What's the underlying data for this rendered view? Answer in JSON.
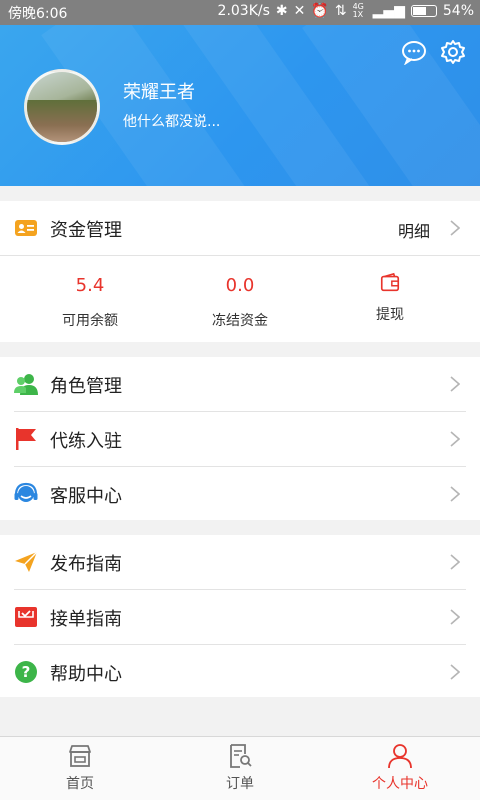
{
  "status": {
    "time": "傍晚6:06",
    "speed": "2.03K/s",
    "net_label": "4G 1X",
    "battery": "54%"
  },
  "profile": {
    "name": "荣耀王者",
    "signature": "他什么都没说..."
  },
  "funds": {
    "title": "资金管理",
    "detail": "明细",
    "available_value": "5.4",
    "available_label": "可用余额",
    "frozen_value": "0.0",
    "frozen_label": "冻结资金",
    "withdraw_label": "提现"
  },
  "menu1": [
    {
      "label": "角色管理",
      "icon": "person-icon"
    },
    {
      "label": "代练入驻",
      "icon": "flag-icon"
    },
    {
      "label": "客服中心",
      "icon": "headset-icon"
    }
  ],
  "menu2": [
    {
      "label": "发布指南",
      "icon": "paper-plane-icon"
    },
    {
      "label": "接单指南",
      "icon": "inbox-icon"
    },
    {
      "label": "帮助中心",
      "icon": "help-icon"
    }
  ],
  "nav": [
    {
      "label": "首页",
      "icon": "store-icon"
    },
    {
      "label": "订单",
      "icon": "order-search-icon"
    },
    {
      "label": "个人中心",
      "icon": "user-icon"
    }
  ],
  "colors": {
    "header": "#2d96ef",
    "accent_red": "#e8342c",
    "funds_icon": "#f4a31f",
    "green": "#3db549",
    "blue_icon": "#2b87e0"
  }
}
